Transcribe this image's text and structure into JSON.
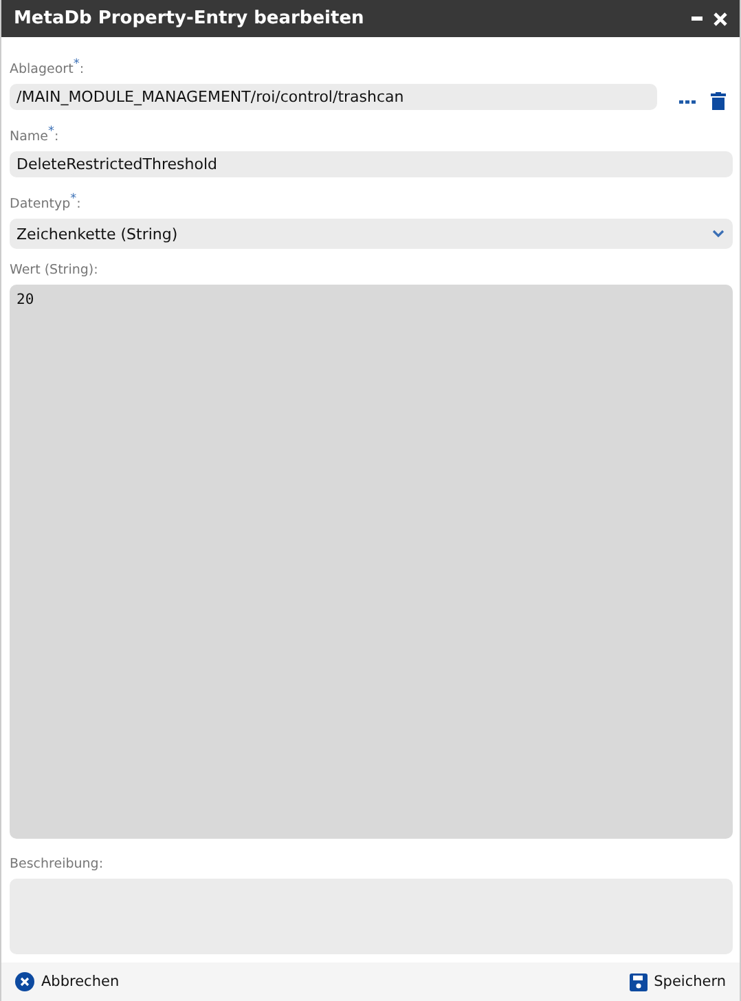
{
  "window": {
    "title": "MetaDb Property-Entry bearbeiten"
  },
  "fields": [
    {
      "label": "Ablageort$^{*}$:",
      "kind": "path",
      "value": "/MAIN_MODULE_MANAGEMENT/roi/control/trashcan"
    },
    {
      "label": "Name$^{*}$:",
      "kind": "text",
      "value": "DeleteRestrictedThreshold"
    },
    {
      "label": "Datentyp$^{*}$:",
      "kind": "select",
      "value": "Zeichenkette (String)"
    },
    {
      "label": "Wert (String):",
      "kind": "code",
      "value": "20"
    },
    {
      "label": "Beschreibung:",
      "kind": "memo"
    }
  ],
  "footer": {
    "cancel": "Abbrechen",
    "save": "Speichern"
  }
}
